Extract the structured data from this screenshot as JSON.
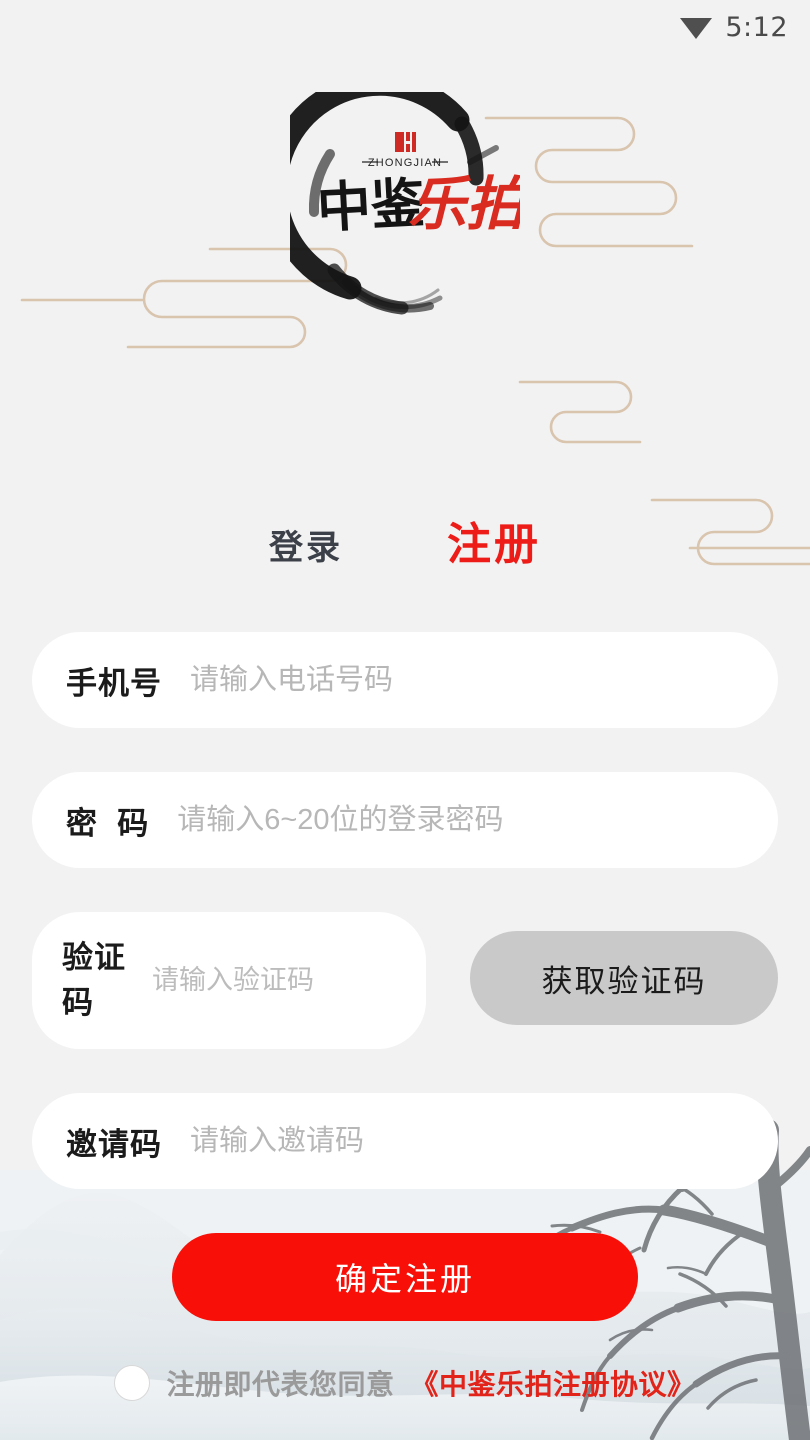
{
  "status_bar": {
    "time": "5:12",
    "wifi_icon": "wifi-icon"
  },
  "logo": {
    "seal_icon": "seal-icon",
    "pinyin": "ZHONGJIAN",
    "brand_black": "中鉴",
    "brand_red": "乐拍",
    "colors": {
      "ink": "#1a1a1a",
      "red": "#d92b1f"
    }
  },
  "tabs": [
    {
      "label": "登录",
      "active": false
    },
    {
      "label": "注册",
      "active": true
    }
  ],
  "form": {
    "phone": {
      "label": "手机号",
      "placeholder": "请输入电话号码",
      "value": ""
    },
    "password": {
      "label": "密  码",
      "placeholder": "请输入6~20位的登录密码",
      "value": ""
    },
    "verify_code": {
      "label": "验证码",
      "placeholder": "请输入验证码",
      "value": "",
      "get_code_label": "获取验证码"
    },
    "invite_code": {
      "label": "邀请码",
      "placeholder": "请输入邀请码",
      "value": ""
    },
    "submit_label": "确定注册"
  },
  "agreement": {
    "checked": false,
    "prefix_text": "注册即代表您同意",
    "link_text": "《中鉴乐拍注册协议》"
  },
  "theme": {
    "page_background": "#f2f2f2",
    "field_background": "#ffffff",
    "accent_red": "#ee1c18",
    "submit_red": "#f70f08",
    "disabled_gray": "#c9c9c9",
    "cloud_line": "#d8c3ad",
    "mountain": "#dfe5e9"
  }
}
